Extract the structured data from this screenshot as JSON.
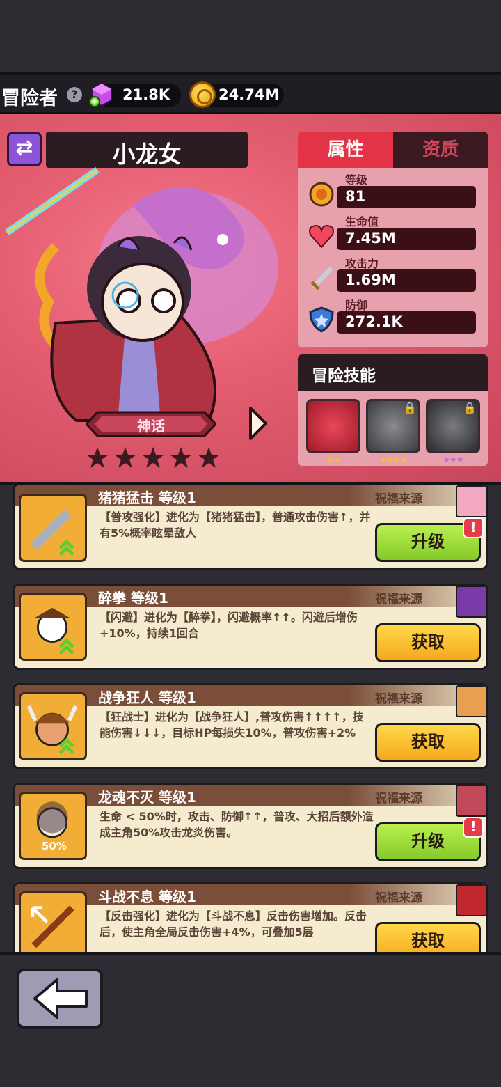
{
  "topbar": {
    "title": "冒险者",
    "help_icon": "?",
    "gems": "21.8K",
    "coins": "24.74M"
  },
  "hero": {
    "name": "小龙女",
    "rarity": "神话",
    "stars": 5
  },
  "stats": {
    "tabs": [
      "属性",
      "资质"
    ],
    "items": [
      {
        "label": "等级",
        "value": "81",
        "icon": "gear-badge-icon"
      },
      {
        "label": "生命值",
        "value": "7.45M",
        "icon": "heart-icon"
      },
      {
        "label": "攻击力",
        "value": "1.69M",
        "icon": "sword-icon"
      },
      {
        "label": "防御",
        "value": "272.1K",
        "icon": "shield-icon"
      }
    ]
  },
  "skills": {
    "title": "冒险技能",
    "items": [
      {
        "icon": "red-dragon-skill-icon",
        "stars": "★★",
        "star_color": "#f7c21a",
        "locked": false
      },
      {
        "icon": "spikes-skill-icon",
        "stars": "★★★★",
        "star_color": "#f7c21a",
        "locked": true
      },
      {
        "icon": "dark-dragon-skill-icon",
        "stars": "★★★",
        "star_color": "#b56cf0",
        "locked": true
      }
    ]
  },
  "cards": [
    {
      "name": "猪猪猛击 等级1",
      "source": "祝福来源",
      "desc": "【普攻强化】进化为【猪猪猛击】，普通攻击伤害↑，并有5%概率眩晕敌人",
      "button": "升级",
      "button_type": "up",
      "alert": "!"
    },
    {
      "name": "醉拳 等级1",
      "source": "祝福来源",
      "desc": "【闪避】进化为【醉拳】，闪避概率↑↑。闪避后增伤+10%，持续1回合",
      "button": "获取",
      "button_type": "get"
    },
    {
      "name": "战争狂人 等级1",
      "source": "祝福来源",
      "desc": "【狂战士】进化为【战争狂人】,普攻伤害↑↑↑↑，技能伤害↓↓↓，目标HP每损失10%，普攻伤害+2%",
      "button": "获取",
      "button_type": "get"
    },
    {
      "name": "龙魂不灭 等级1",
      "source": "祝福来源",
      "desc": "生命 < 50%时，攻击、防御↑↑，普攻、大招后额外造成主角50%攻击龙炎伤害。",
      "button": "升级",
      "button_type": "up",
      "alert": "!",
      "icon_badge": "50%"
    },
    {
      "name": "斗战不息 等级1",
      "source": "祝福来源",
      "desc": "【反击强化】进化为【斗战不息】反击伤害增加。反击后，使主角全局反击伤害+4%，可叠加5层",
      "button": "获取",
      "button_type": "get"
    }
  ],
  "bottom": {
    "back_icon": "back-arrow-icon"
  }
}
